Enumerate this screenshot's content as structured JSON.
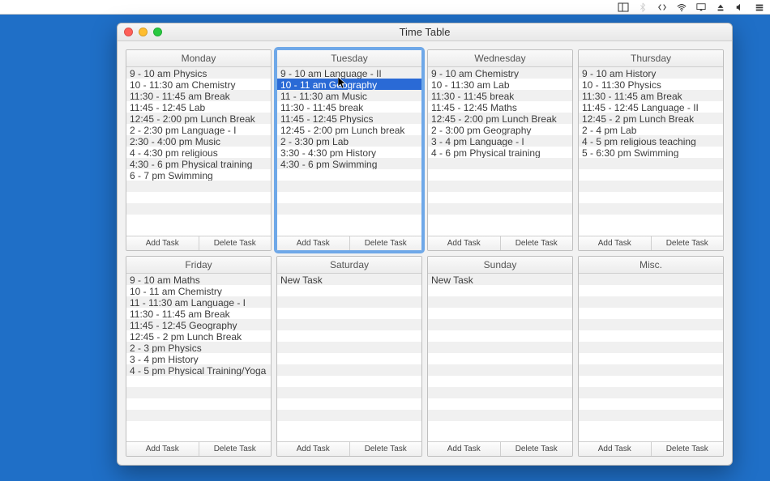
{
  "window_title": "Time Table",
  "buttons": {
    "add": "Add Task",
    "delete": "Delete Task"
  },
  "days": [
    {
      "name": "Monday",
      "active": false,
      "tasks": [
        "9 - 10 am Physics",
        "10 - 11:30 am Chemistry",
        "11:30 - 11:45 am Break",
        "11:45 - 12:45 Lab",
        "12:45 - 2:00 pm Lunch Break",
        "2 - 2:30 pm Language - I",
        "2:30 - 4:00 pm Music",
        "4 - 4:30 pm religious",
        "4:30 - 6 pm Physical training",
        "6 - 7 pm Swimming"
      ],
      "selected": -1
    },
    {
      "name": "Tuesday",
      "active": true,
      "tasks": [
        "9 - 10 am Language - II",
        "10 - 11 am Geography",
        "11 - 11:30 am Music",
        "11:30 - 11:45 break",
        "11:45 - 12:45 Physics",
        "12:45 - 2:00 pm Lunch break",
        "2 - 3:30 pm Lab",
        "3:30 - 4:30 pm History",
        "4:30 - 6 pm Swimming"
      ],
      "selected": 1
    },
    {
      "name": "Wednesday",
      "active": false,
      "tasks": [
        "9 - 10 am Chemistry",
        "10 - 11:30 am Lab",
        "11:30 - 11:45 break",
        "11:45 - 12:45 Maths",
        "12:45 - 2:00 pm Lunch Break",
        "2 - 3:00 pm Geography",
        "3 - 4 pm Language - I",
        "4 - 6 pm Physical training"
      ],
      "selected": -1
    },
    {
      "name": "Thursday",
      "active": false,
      "tasks": [
        "9 - 10 am History",
        "10 - 11:30 Physics",
        "11:30 - 11:45 am Break",
        "11:45 - 12:45 Language - II",
        "12:45 - 2 pm Lunch Break",
        "2 - 4 pm Lab",
        "4 - 5 pm religious teaching",
        "5 - 6:30 pm Swimming"
      ],
      "selected": -1
    },
    {
      "name": "Friday",
      "active": false,
      "tasks": [
        "9 - 10 am Maths",
        "10 - 11 am Chemistry",
        "11 - 11:30 am Language - I",
        "11:30 - 11:45 am Break",
        "11:45 - 12:45 Geography",
        "12:45 - 2 pm Lunch Break",
        "2 - 3 pm Physics",
        "3 - 4 pm History",
        "4 - 5 pm Physical Training/Yoga"
      ],
      "selected": -1
    },
    {
      "name": "Saturday",
      "active": false,
      "tasks": [
        "New Task"
      ],
      "selected": -1
    },
    {
      "name": "Sunday",
      "active": false,
      "tasks": [
        "New Task"
      ],
      "selected": -1
    },
    {
      "name": "Misc.",
      "active": false,
      "tasks": [],
      "selected": -1
    }
  ]
}
